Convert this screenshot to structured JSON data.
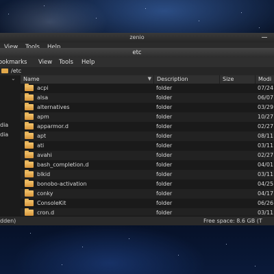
{
  "back_window": {
    "title": "zenio",
    "menu": [
      "View",
      "Tools",
      "Help"
    ]
  },
  "window": {
    "title": "etc",
    "menu": [
      "Bookmarks",
      "View",
      "Tools",
      "Help"
    ],
    "location": "/etc"
  },
  "sidebar": {
    "items": [
      "dia",
      "dia"
    ]
  },
  "columns": {
    "name": "Name",
    "description": "Description",
    "size": "Size",
    "modified": "Modi"
  },
  "files": [
    {
      "name": "acpi",
      "description": "folder",
      "size": "",
      "modified": "07/24"
    },
    {
      "name": "alsa",
      "description": "folder",
      "size": "",
      "modified": "06/07"
    },
    {
      "name": "alternatives",
      "description": "folder",
      "size": "",
      "modified": "03/29"
    },
    {
      "name": "apm",
      "description": "folder",
      "size": "",
      "modified": "10/27"
    },
    {
      "name": "apparmor.d",
      "description": "folder",
      "size": "",
      "modified": "02/27"
    },
    {
      "name": "apt",
      "description": "folder",
      "size": "",
      "modified": "08/11"
    },
    {
      "name": "ati",
      "description": "folder",
      "size": "",
      "modified": "03/11"
    },
    {
      "name": "avahi",
      "description": "folder",
      "size": "",
      "modified": "02/27"
    },
    {
      "name": "bash_completion.d",
      "description": "folder",
      "size": "",
      "modified": "04/01"
    },
    {
      "name": "blkid",
      "description": "folder",
      "size": "",
      "modified": "03/11"
    },
    {
      "name": "bonobo-activation",
      "description": "folder",
      "size": "",
      "modified": "04/25"
    },
    {
      "name": "conky",
      "description": "folder",
      "size": "",
      "modified": "04/17"
    },
    {
      "name": "ConsoleKit",
      "description": "folder",
      "size": "",
      "modified": "06/26"
    },
    {
      "name": "cron.d",
      "description": "folder",
      "size": "",
      "modified": "03/11"
    }
  ],
  "status": {
    "left": "dden)",
    "right": "Free space: 8.6 GB (T"
  },
  "colors": {
    "folder": "#e1a84a",
    "window_bg": "#1e1e1e",
    "titlebar": "#3a3a3a"
  }
}
